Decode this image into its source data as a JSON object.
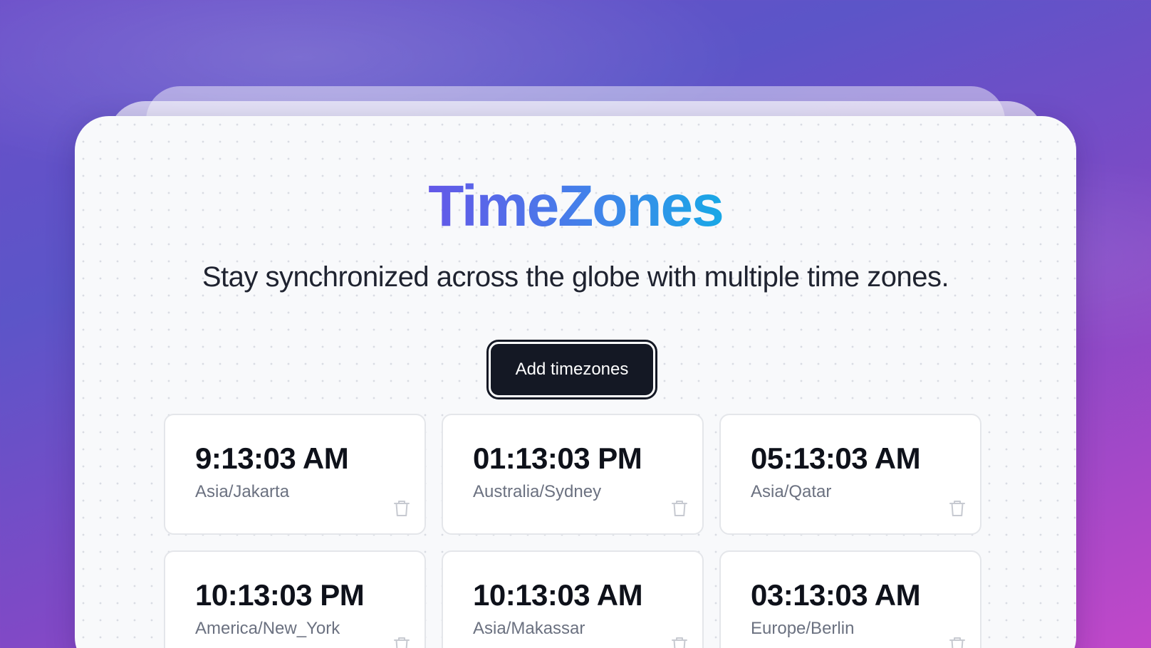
{
  "app": {
    "title": "TimeZones",
    "subtitle": "Stay synchronized across the globe with multiple time zones."
  },
  "actions": {
    "add_label": "Add timezones"
  },
  "clocks": [
    {
      "time": "9:13:03 AM",
      "zone": "Asia/Jakarta"
    },
    {
      "time": "01:13:03 PM",
      "zone": "Australia/Sydney"
    },
    {
      "time": "05:13:03 AM",
      "zone": "Asia/Qatar"
    },
    {
      "time": "10:13:03 PM",
      "zone": "America/New_York"
    },
    {
      "time": "10:13:03 AM",
      "zone": "Asia/Makassar"
    },
    {
      "time": "03:13:03 AM",
      "zone": "Europe/Berlin"
    }
  ],
  "icons": {
    "delete": "trash-icon"
  },
  "colors": {
    "title_gradient_start": "#6458e8",
    "title_gradient_end": "#18a8e6",
    "button_bg": "#141824",
    "time_text": "#0e111a",
    "zone_text": "#6b7180"
  }
}
